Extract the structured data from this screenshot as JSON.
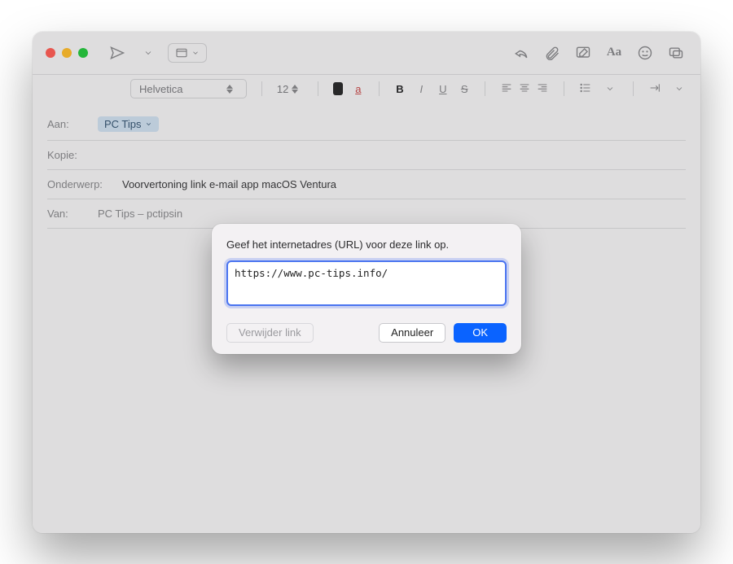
{
  "formatbar": {
    "font": "Helvetica",
    "size": "12",
    "bold": "B",
    "italic": "I",
    "underline": "U",
    "strike": "S",
    "text_color_swatch": "#2c2c2e",
    "color_letter": "a"
  },
  "headers": {
    "to_label": "Aan:",
    "to_token": "PC Tips",
    "cc_label": "Kopie:",
    "subject_label": "Onderwerp:",
    "subject_value": "Voorvertoning link e-mail app macOS Ventura",
    "from_label": "Van:",
    "from_value": "PC Tips – pctipsin"
  },
  "modal": {
    "title": "Geef het internetadres (URL) voor deze link op.",
    "url_value": "https://www.pc-tips.info/",
    "remove_label": "Verwijder link",
    "cancel_label": "Annuleer",
    "ok_label": "OK"
  }
}
